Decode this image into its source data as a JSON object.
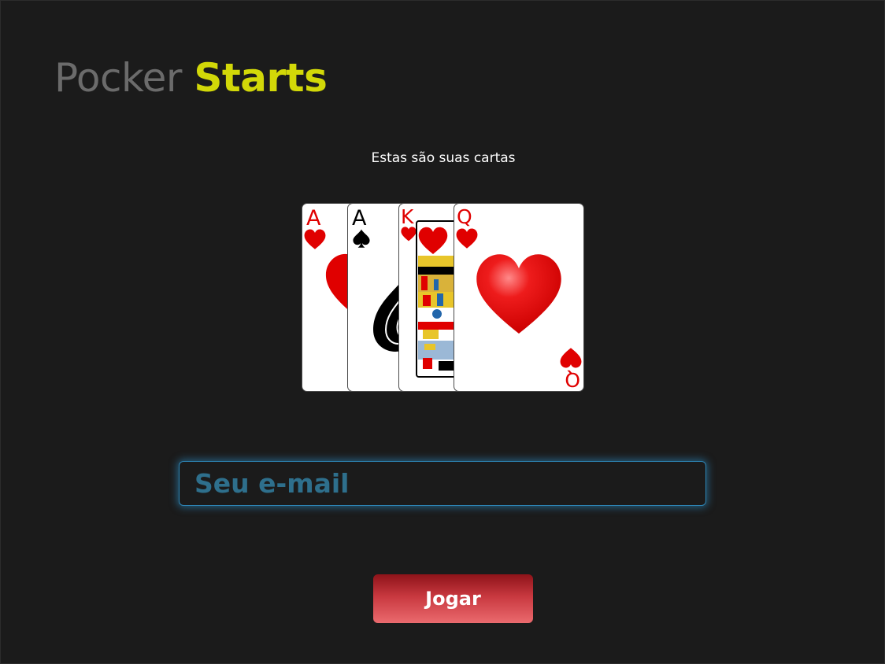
{
  "header": {
    "logo_light": "Pocker",
    "logo_bold": "Starts"
  },
  "main": {
    "subtitle": "Estas são suas cartas",
    "cards": [
      {
        "rank": "A",
        "suit": "hearts",
        "suit_icon": "heart-icon",
        "color": "#e00000"
      },
      {
        "rank": "A",
        "suit": "spades",
        "suit_icon": "spade-icon",
        "color": "#000000"
      },
      {
        "rank": "K",
        "suit": "hearts",
        "suit_icon": "heart-icon",
        "color": "#e00000"
      },
      {
        "rank": "Q",
        "suit": "hearts",
        "suit_icon": "heart-icon",
        "color": "#e00000"
      }
    ]
  },
  "form": {
    "email_placeholder": "Seu e-mail",
    "submit_label": "Jogar"
  },
  "colors": {
    "background": "#1b1b1b",
    "logo_light": "#6b6b6b",
    "logo_accent": "#d2d808",
    "input_text": "#2e6f8c",
    "input_glow": "#2d84b4",
    "button": "#c8383f"
  }
}
